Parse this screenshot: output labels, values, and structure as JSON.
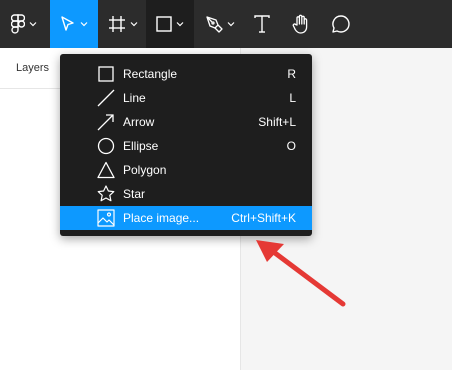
{
  "toolbar": {
    "tools": [
      {
        "name": "figma-menu",
        "icon": "figma-logo-icon"
      },
      {
        "name": "move",
        "icon": "cursor-arrow-icon",
        "state": "active"
      },
      {
        "name": "frame",
        "icon": "hash-frame-icon"
      },
      {
        "name": "shape",
        "icon": "square-icon",
        "state": "open"
      },
      {
        "name": "pen",
        "icon": "pen-icon"
      },
      {
        "name": "text",
        "icon": "text-t-icon"
      },
      {
        "name": "hand",
        "icon": "hand-icon"
      },
      {
        "name": "comment",
        "icon": "comment-bubble-icon"
      }
    ]
  },
  "layers_panel": {
    "title": "Layers"
  },
  "shape_menu": {
    "items": [
      {
        "label": "Rectangle",
        "shortcut": "R",
        "icon": "square-icon"
      },
      {
        "label": "Line",
        "shortcut": "L",
        "icon": "line-icon"
      },
      {
        "label": "Arrow",
        "shortcut": "Shift+L",
        "icon": "arrow-icon"
      },
      {
        "label": "Ellipse",
        "shortcut": "O",
        "icon": "circle-icon"
      },
      {
        "label": "Polygon",
        "shortcut": "",
        "icon": "triangle-icon"
      },
      {
        "label": "Star",
        "shortcut": "",
        "icon": "star-icon"
      },
      {
        "label": "Place image...",
        "shortcut": "Ctrl+Shift+K",
        "icon": "image-icon",
        "highlighted": true
      }
    ]
  },
  "colors": {
    "toolbar_bg": "#2c2c2c",
    "accent_blue": "#0d99ff",
    "menu_bg": "#1e1e1e",
    "annotation_red": "#e53935"
  }
}
